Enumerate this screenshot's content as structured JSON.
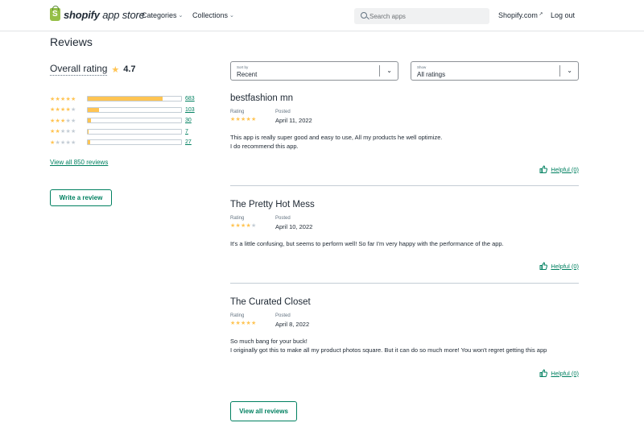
{
  "header": {
    "logo": {
      "bold": "shopify",
      "light": " app store"
    },
    "nav": [
      {
        "label": "Categories"
      },
      {
        "label": "Collections"
      }
    ],
    "search": {
      "placeholder": "Search apps"
    },
    "shopify_link": "Shopify.com",
    "logout": "Log out"
  },
  "page": {
    "title": "Reviews",
    "overall_label": "Overall rating",
    "overall_value": "4.7"
  },
  "histogram": [
    {
      "stars": 5,
      "count": "683",
      "fraction": 0.8
    },
    {
      "stars": 4,
      "count": "103",
      "fraction": 0.12
    },
    {
      "stars": 3,
      "count": "30",
      "fraction": 0.035
    },
    {
      "stars": 2,
      "count": "7",
      "fraction": 0.01
    },
    {
      "stars": 1,
      "count": "27",
      "fraction": 0.03
    }
  ],
  "view_all_link": "View all 850 reviews",
  "write_review": "Write a review",
  "filters": {
    "sort": {
      "label": "Sort by",
      "value": "Recent"
    },
    "show": {
      "label": "Show",
      "value": "All ratings"
    }
  },
  "reviews": [
    {
      "title": "bestfashion mn",
      "rating_label": "Rating",
      "posted_label": "Posted",
      "stars": 5,
      "date": "April 11, 2022",
      "body": [
        "This app is really super good and easy to use, All my products he well optimize.",
        "I do recommend this app."
      ],
      "helpful": "Helpful (0)"
    },
    {
      "title": "The Pretty Hot Mess",
      "rating_label": "Rating",
      "posted_label": "Posted",
      "stars": 4,
      "date": "April 10, 2022",
      "body": [
        "It's a little confusing, but seems to perform well! So far I'm very happy with the performance of the app."
      ],
      "helpful": "Helpful (0)"
    },
    {
      "title": "The Curated Closet",
      "rating_label": "Rating",
      "posted_label": "Posted",
      "stars": 5,
      "date": "April 8, 2022",
      "body": [
        "So much bang for your buck!",
        "I originally got this to make all my product photos square. But it can do so much more! You won't regret getting this app"
      ],
      "helpful": "Helpful (0)"
    }
  ],
  "view_all_button": "View all reviews",
  "colors": {
    "accent": "#008060",
    "star": "#ffc453",
    "star_off": "#c4cdd5",
    "logo_green": "#95bf47"
  },
  "icons": {
    "search": "search-icon",
    "thumbs_up": "thumbs-up-icon",
    "chevron": "chevron-down-icon",
    "star": "star-icon"
  }
}
